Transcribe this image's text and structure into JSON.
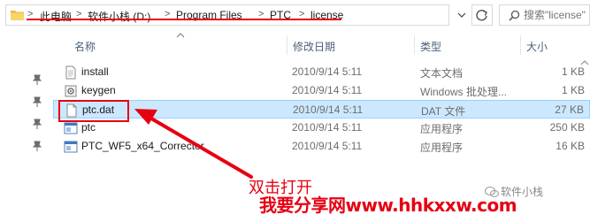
{
  "address": {
    "crumbs": [
      "此电脑",
      "软件小栈 (D:)",
      "Program Files",
      "PTC",
      "license"
    ],
    "separator": ">",
    "search_placeholder": "搜索\"license\""
  },
  "columns": {
    "name": "名称",
    "date": "修改日期",
    "type": "类型",
    "size": "大小"
  },
  "files": [
    {
      "name": "install",
      "date": "2010/9/14 5:11",
      "type": "文本文档",
      "size": "1 KB",
      "icon": "text-file-icon"
    },
    {
      "name": "keygen",
      "date": "2010/9/14 5:11",
      "type": "Windows 批处理...",
      "size": "1 KB",
      "icon": "batch-file-icon"
    },
    {
      "name": "ptc.dat",
      "date": "2010/9/14 5:11",
      "type": "DAT 文件",
      "size": "27 KB",
      "icon": "dat-file-icon",
      "selected": true
    },
    {
      "name": "ptc",
      "date": "2010/9/14 5:11",
      "type": "应用程序",
      "size": "250 KB",
      "icon": "app-icon"
    },
    {
      "name": "PTC_WF5_x64_Corrector",
      "date": "2010/9/14 5:11",
      "type": "应用程序",
      "size": "16 KB",
      "icon": "app-icon"
    }
  ],
  "annotation": {
    "label": "双击打开",
    "watermark": "我要分享网www.hhkxxw.com",
    "wechat": "软件小栈"
  },
  "colors": {
    "accent": "#e60012",
    "selection": "#cce8ff",
    "header_text": "#4c607a"
  }
}
